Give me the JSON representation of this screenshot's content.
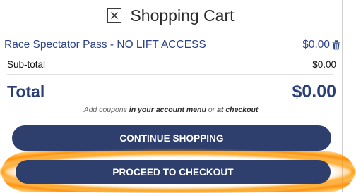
{
  "header": {
    "title": "Shopping Cart",
    "close_icon": "close-square-icon"
  },
  "cart": {
    "items": [
      {
        "name": "Race Spectator Pass - NO LIFT ACCESS",
        "price": "$0.00",
        "remove_icon": "trash-icon"
      }
    ],
    "subtotal_label": "Sub-total",
    "subtotal_value": "$0.00",
    "total_label": "Total",
    "total_value": "$0.00"
  },
  "coupon": {
    "prefix": "Add coupons ",
    "link1": "in your account menu",
    "middle": " or ",
    "link2": "at checkout"
  },
  "buttons": {
    "continue_label": "CONTINUE SHOPPING",
    "checkout_label": "PROCEED TO CHECKOUT"
  },
  "colors": {
    "brand_navy": "#2e3f6e",
    "link_blue": "#2c4485",
    "highlight_orange": "#ff9a00"
  }
}
